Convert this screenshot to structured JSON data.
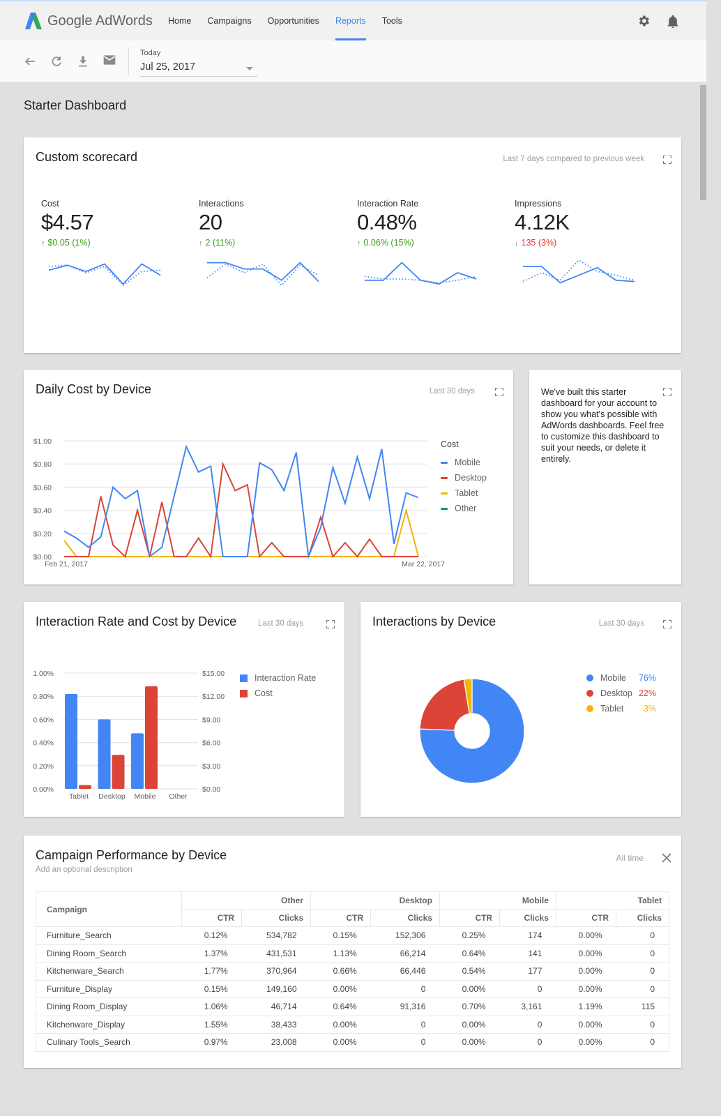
{
  "app": {
    "brand": "Google AdWords",
    "nav": [
      {
        "label": "Home",
        "active": false
      },
      {
        "label": "Campaigns",
        "active": false
      },
      {
        "label": "Opportunities",
        "active": false
      },
      {
        "label": "Reports",
        "active": true
      },
      {
        "label": "Tools",
        "active": false
      }
    ],
    "icons": [
      "gear-icon",
      "bell-icon"
    ],
    "accent": "#4285f4"
  },
  "toolbar": {
    "icons": [
      "back-arrow-icon",
      "refresh-icon",
      "download-icon",
      "email-icon"
    ],
    "date_label": "Today",
    "date_value": "Jul 25, 2017"
  },
  "page": {
    "title": "Starter Dashboard"
  },
  "scorecard": {
    "title": "Custom scorecard",
    "range": "Last 7 days compared to previous week",
    "metrics": [
      {
        "label": "Cost",
        "value": "$4.57",
        "delta": "$0.05 (1%)",
        "direction": "up",
        "current": [
          0.6,
          0.8,
          0.55,
          0.85,
          0.05,
          0.85,
          0.4
        ],
        "previous": [
          0.75,
          0.8,
          0.5,
          0.75,
          0.0,
          0.55,
          0.6
        ]
      },
      {
        "label": "Interactions",
        "value": "20",
        "delta": "2 (11%)",
        "direction": "up",
        "current": [
          0.9,
          0.9,
          0.65,
          0.65,
          0.2,
          0.9,
          0.15
        ],
        "previous": [
          0.3,
          0.85,
          0.5,
          0.85,
          0.0,
          0.8,
          0.4
        ]
      },
      {
        "label": "Interaction Rate",
        "value": "0.48%",
        "delta": "0.06% (15%)",
        "direction": "up",
        "current": [
          0.2,
          0.2,
          0.9,
          0.2,
          0.05,
          0.5,
          0.25
        ],
        "previous": [
          0.35,
          0.25,
          0.25,
          0.2,
          0.1,
          0.2,
          0.35
        ]
      },
      {
        "label": "Impressions",
        "value": "4.12K",
        "delta": "135 (3%)",
        "direction": "down",
        "current": [
          0.75,
          0.75,
          0.1,
          0.4,
          0.7,
          0.2,
          0.15
        ],
        "previous": [
          0.15,
          0.5,
          0.2,
          1.0,
          0.55,
          0.4,
          0.2
        ]
      }
    ]
  },
  "daily_cost": {
    "title": "Daily Cost by Device",
    "range": "Last 30 days"
  },
  "info_card": {
    "text": "We've built this starter dashboard for your account to show you what's possible with AdWords dashboards. Feel free to customize this dashboard to suit your needs, or delete it entirely."
  },
  "rate_cost": {
    "title": "Interaction Rate and Cost by Device",
    "range": "Last 30 days"
  },
  "interactions": {
    "title": "Interactions by Device",
    "range": "Last 30 days"
  },
  "chart_data": [
    {
      "type": "line",
      "title": "Daily Cost by Device",
      "x_start_label": "Feb 21, 2017",
      "x_end_label": "Mar 22, 2017",
      "ylabel": "",
      "ylim": [
        0,
        1.0
      ],
      "yticks": [
        "$0.00",
        "$0.20",
        "$0.40",
        "$0.60",
        "$0.80",
        "$1.00"
      ],
      "legend_title": "Cost",
      "legend_position": "right",
      "grid": true,
      "series": [
        {
          "name": "Mobile",
          "color": "#4285f4",
          "values": [
            0.22,
            0.16,
            0.08,
            0.17,
            0.6,
            0.5,
            0.57,
            0.0,
            0.08,
            0.52,
            0.95,
            0.73,
            0.78,
            0.0,
            0.0,
            0.0,
            0.81,
            0.75,
            0.57,
            0.9,
            0.0,
            0.25,
            0.77,
            0.46,
            0.86,
            0.5,
            0.93,
            0.11,
            0.55,
            0.51
          ]
        },
        {
          "name": "Desktop",
          "color": "#db4437",
          "values": [
            0.0,
            0.0,
            0.0,
            0.52,
            0.1,
            0.0,
            0.4,
            0.0,
            0.47,
            0.0,
            0.0,
            0.16,
            0.0,
            0.8,
            0.57,
            0.62,
            0.0,
            0.12,
            0.0,
            0.0,
            0.0,
            0.34,
            0.0,
            0.12,
            0.0,
            0.15,
            0.0,
            0.0,
            0.0,
            0.0
          ]
        },
        {
          "name": "Tablet",
          "color": "#f4b400",
          "values": [
            0.14,
            0.0,
            0.0,
            0.0,
            0.0,
            0.0,
            0.0,
            0.0,
            0.0,
            0.0,
            0.0,
            0.0,
            0.0,
            0.0,
            0.0,
            0.0,
            0.0,
            0.0,
            0.0,
            0.0,
            0.0,
            0.0,
            0.0,
            0.0,
            0.0,
            0.0,
            0.0,
            0.0,
            0.4,
            0.0
          ]
        },
        {
          "name": "Other",
          "color": "#0f9d58",
          "values": []
        }
      ]
    },
    {
      "type": "bar",
      "title": "Interaction Rate and Cost by Device",
      "categories": [
        "Tablet",
        "Desktop",
        "Mobile",
        "Other"
      ],
      "series": [
        {
          "name": "Interaction Rate",
          "color": "#4285f4",
          "axis": "left",
          "values": [
            0.82,
            0.6,
            0.48,
            0
          ]
        },
        {
          "name": "Cost",
          "color": "#db4437",
          "axis": "right",
          "values": [
            0.5,
            4.4,
            13.3,
            0
          ]
        }
      ],
      "ylim_left": [
        0,
        1.0
      ],
      "ylim_right": [
        0,
        15
      ],
      "yticks_left": [
        "0.00%",
        "0.20%",
        "0.40%",
        "0.60%",
        "0.80%",
        "1.00%"
      ],
      "yticks_right": [
        "$0.00",
        "$3.00",
        "$6.00",
        "$9.00",
        "$12.00",
        "$15.00"
      ],
      "legend_position": "right",
      "grid": true
    },
    {
      "type": "pie",
      "title": "Interactions by Device",
      "donut": true,
      "slices": [
        {
          "name": "Mobile",
          "value": 76,
          "label": "76%",
          "color": "#4285f4"
        },
        {
          "name": "Desktop",
          "value": 22,
          "label": "22%",
          "color": "#db4437"
        },
        {
          "name": "Tablet",
          "value": 2.5,
          "label": "3%",
          "color": "#f4b400"
        }
      ],
      "legend_position": "right"
    }
  ],
  "table": {
    "title": "Campaign Performance by Device",
    "description_placeholder": "Add an optional description",
    "range": "All time",
    "group_headers": [
      "Other",
      "Desktop",
      "Mobile",
      "Tablet"
    ],
    "first_col": "Campaign",
    "sub_headers": [
      "CTR",
      "Clicks",
      "CTR",
      "Clicks",
      "CTR",
      "Clicks",
      "CTR",
      "Clicks"
    ],
    "rows": [
      [
        "Furniture_Search",
        "0.12%",
        "534,782",
        "0.15%",
        "152,306",
        "0.25%",
        "174",
        "0.00%",
        "0"
      ],
      [
        "Dining Room_Search",
        "1.37%",
        "431,531",
        "1.13%",
        "66,214",
        "0.64%",
        "141",
        "0.00%",
        "0"
      ],
      [
        "Kitchenware_Search",
        "1.77%",
        "370,964",
        "0.66%",
        "66,446",
        "0.54%",
        "177",
        "0.00%",
        "0"
      ],
      [
        "Furniture_Display",
        "0.15%",
        "149,160",
        "0.00%",
        "0",
        "0.00%",
        "0",
        "0.00%",
        "0"
      ],
      [
        "Dining Room_Display",
        "1.06%",
        "46,714",
        "0.64%",
        "91,316",
        "0.70%",
        "3,161",
        "1.19%",
        "115"
      ],
      [
        "Kitchenware_Display",
        "1.55%",
        "38,433",
        "0.00%",
        "0",
        "0.00%",
        "0",
        "0.00%",
        "0"
      ],
      [
        "Culinary Tools_Search",
        "0.97%",
        "23,008",
        "0.00%",
        "0",
        "0.00%",
        "0",
        "0.00%",
        "0"
      ]
    ]
  }
}
